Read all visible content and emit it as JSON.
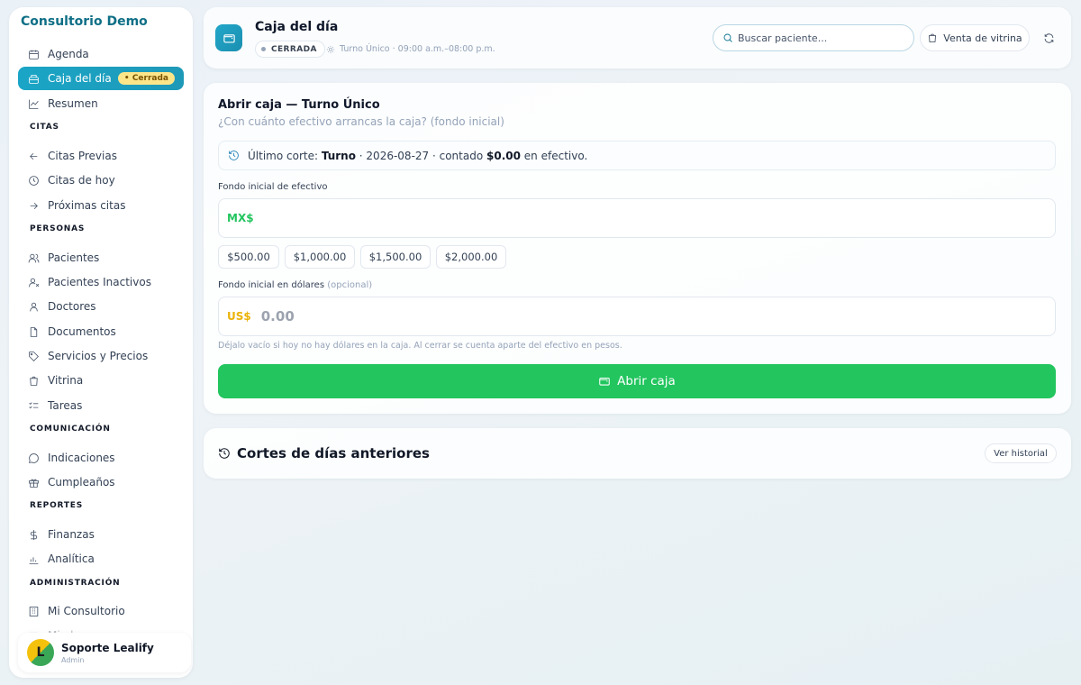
{
  "sidebar": {
    "brand": "Consultorio Demo",
    "top_items": [
      {
        "label": "Agenda",
        "icon": "calendar-icon"
      },
      {
        "label": "Caja del día",
        "icon": "cash-register-icon",
        "badge": "Cerrada",
        "active": true
      },
      {
        "label": "Resumen",
        "icon": "trend-chart-icon"
      }
    ],
    "sections": [
      {
        "title": "CITAS",
        "items": [
          {
            "label": "Citas Previas",
            "icon": "arrow-left-icon"
          },
          {
            "label": "Citas de hoy",
            "icon": "clock-icon"
          },
          {
            "label": "Próximas citas",
            "icon": "arrow-right-icon"
          }
        ]
      },
      {
        "title": "PERSONAS",
        "items": [
          {
            "label": "Pacientes",
            "icon": "users-icon"
          },
          {
            "label": "Pacientes Inactivos",
            "icon": "user-x-icon"
          },
          {
            "label": "Doctores",
            "icon": "user-icon"
          },
          {
            "label": "Documentos",
            "icon": "file-icon"
          },
          {
            "label": "Servicios y Precios",
            "icon": "tag-icon"
          },
          {
            "label": "Vitrina",
            "icon": "shopping-bag-icon"
          },
          {
            "label": "Tareas",
            "icon": "list-checks-icon"
          }
        ]
      },
      {
        "title": "COMUNICACIÓN",
        "items": [
          {
            "label": "Indicaciones",
            "icon": "message-circle-icon"
          },
          {
            "label": "Cumpleaños",
            "icon": "gift-icon"
          }
        ]
      },
      {
        "title": "REPORTES",
        "items": [
          {
            "label": "Finanzas",
            "icon": "dollar-icon"
          },
          {
            "label": "Analítica",
            "icon": "bar-chart-icon"
          }
        ]
      },
      {
        "title": "ADMINISTRACIÓN",
        "items": [
          {
            "label": "Mi Consultorio",
            "icon": "building-icon"
          },
          {
            "label": "Mi plan",
            "icon": "credit-card-icon"
          }
        ]
      }
    ],
    "user": {
      "name": "Soporte Lealify",
      "role": "Admin",
      "avatar_letter": "L"
    }
  },
  "header": {
    "title": "Caja del día",
    "status": "CERRADA",
    "shift": "Turno Único · 09:00 a.m.–08:00 p.m.",
    "search_placeholder": "Buscar paciente...",
    "vitrina_label": "Venta de vitrina"
  },
  "open_cash": {
    "title": "Abrir caja — Turno Único",
    "subtitle": "¿Con cuánto efectivo arrancas la caja? (fondo inicial)",
    "last_cut": {
      "prefix": "Último corte:",
      "shift": "Turno",
      "date_text": "· 2026-08-27 · contado",
      "amount": "$0.00",
      "suffix": "en efectivo."
    },
    "mxn_label": "Fondo inicial de efectivo",
    "mxn_currency": "MX$",
    "mxn_value": "",
    "quick_amounts": [
      "$500.00",
      "$1,000.00",
      "$1,500.00",
      "$2,000.00"
    ],
    "usd_label": "Fondo inicial en dólares",
    "usd_optional": "(opcional)",
    "usd_currency": "US$",
    "usd_placeholder": "0.00",
    "hint": "Déjalo vacío si hoy no hay dólares en la caja. Al cerrar se cuenta aparte del efectivo en pesos.",
    "open_button": "Abrir caja"
  },
  "previous_cuts": {
    "title": "Cortes de días anteriores",
    "history_button": "Ver historial"
  },
  "colors": {
    "accent": "#1aa5c6",
    "brand": "#0e6f86",
    "success": "#22c55e",
    "mxn": "#22c55e",
    "usd": "#eab308",
    "badge": "#fde68a"
  }
}
